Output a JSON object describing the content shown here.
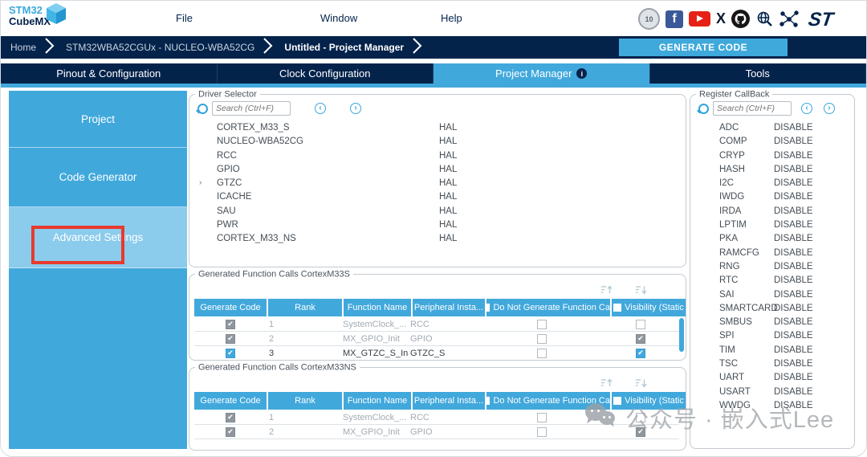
{
  "colors": {
    "accent": "#41a8dc",
    "navy": "#03234b",
    "sidebar_selected": "#8bcbec",
    "red_annotation": "#e8392d",
    "youtube_red": "#e62117",
    "facebook_blue": "#3b5998"
  },
  "menubar": {
    "brand_line1": "STM32",
    "brand_line2": "CubeMX",
    "items": [
      "File",
      "Window",
      "Help"
    ],
    "icons": [
      "badge-10-years-icon",
      "facebook-icon",
      "youtube-icon",
      "x-twitter-icon",
      "github-icon",
      "search-globe-icon",
      "community-icon",
      "st-logo-icon"
    ],
    "badge_text": "10"
  },
  "breadcrumb": {
    "items": [
      "Home",
      "STM32WBA52CGUx - NUCLEO-WBA52CG",
      "Untitled - Project Manager"
    ],
    "generate_button": "GENERATE CODE"
  },
  "tabs": [
    {
      "label": "Pinout & Configuration",
      "active": false,
      "info": false
    },
    {
      "label": "Clock Configuration",
      "active": false,
      "info": false
    },
    {
      "label": "Project Manager",
      "active": true,
      "info": true
    },
    {
      "label": "Tools",
      "active": false,
      "info": false
    }
  ],
  "sidebar": {
    "items": [
      {
        "label": "Project",
        "selected": false,
        "annotated": false
      },
      {
        "label": "Code Generator",
        "selected": false,
        "annotated": false
      },
      {
        "label": "Advanced Settings",
        "selected": true,
        "annotated": true
      }
    ]
  },
  "driver_selector": {
    "title": "Driver Selector",
    "search_placeholder": "Search (Ctrl+F)",
    "rows": [
      {
        "name": "CORTEX_M33_S",
        "driver": "HAL",
        "expandable": false
      },
      {
        "name": "NUCLEO-WBA52CG",
        "driver": "HAL",
        "expandable": false
      },
      {
        "name": "RCC",
        "driver": "HAL",
        "expandable": false
      },
      {
        "name": "GPIO",
        "driver": "HAL",
        "expandable": false
      },
      {
        "name": "GTZC",
        "driver": "HAL",
        "expandable": true
      },
      {
        "name": "ICACHE",
        "driver": "HAL",
        "expandable": false
      },
      {
        "name": "SAU",
        "driver": "HAL",
        "expandable": false
      },
      {
        "name": "PWR",
        "driver": "HAL",
        "expandable": false
      },
      {
        "name": "CORTEX_M33_NS",
        "driver": "HAL",
        "expandable": false
      }
    ]
  },
  "generated_calls_s": {
    "title": "Generated Function Calls CortexM33S",
    "columns": [
      {
        "label": "Generate Code",
        "checkbox": false
      },
      {
        "label": "Rank",
        "checkbox": false
      },
      {
        "label": "Function Name",
        "checkbox": false
      },
      {
        "label": "Peripheral Insta...",
        "checkbox": false
      },
      {
        "label": "Do Not Generate Function Ca",
        "checkbox": true
      },
      {
        "label": "Visibility (Static",
        "checkbox": true
      }
    ],
    "rows": [
      {
        "generate": "on-gray",
        "rank": "1",
        "function": "SystemClock_...",
        "peripheral": "RCC",
        "do_not_generate": "off",
        "visibility": "off",
        "muted": true
      },
      {
        "generate": "on-gray",
        "rank": "2",
        "function": "MX_GPIO_Init",
        "peripheral": "GPIO",
        "do_not_generate": "off",
        "visibility": "on-gray",
        "muted": true
      },
      {
        "generate": "on-blue",
        "rank": "3",
        "function": "MX_GTZC_S_Init",
        "peripheral": "GTZC_S",
        "do_not_generate": "off",
        "visibility": "on-blue",
        "muted": false
      }
    ],
    "has_scrollbar": true
  },
  "generated_calls_ns": {
    "title": "Generated Function Calls CortexM33NS",
    "columns": [
      {
        "label": "Generate Code",
        "checkbox": false
      },
      {
        "label": "Rank",
        "checkbox": false
      },
      {
        "label": "Function Name",
        "checkbox": false
      },
      {
        "label": "Peripheral Insta...",
        "checkbox": false
      },
      {
        "label": "Do Not Generate Function Ca",
        "checkbox": true
      },
      {
        "label": "Visibility (Static",
        "checkbox": true
      }
    ],
    "rows": [
      {
        "generate": "on-gray",
        "rank": "1",
        "function": "SystemClock_...",
        "peripheral": "RCC",
        "do_not_generate": "off",
        "visibility": "off",
        "muted": true
      },
      {
        "generate": "on-gray",
        "rank": "2",
        "function": "MX_GPIO_Init",
        "peripheral": "GPIO",
        "do_not_generate": "off",
        "visibility": "on-gray",
        "muted": true
      }
    ],
    "has_scrollbar": false
  },
  "register_callback": {
    "title": "Register CallBack",
    "search_placeholder": "Search (Ctrl+F)",
    "rows": [
      {
        "peripheral": "ADC",
        "value": "DISABLE"
      },
      {
        "peripheral": "COMP",
        "value": "DISABLE"
      },
      {
        "peripheral": "CRYP",
        "value": "DISABLE"
      },
      {
        "peripheral": "HASH",
        "value": "DISABLE"
      },
      {
        "peripheral": "I2C",
        "value": "DISABLE"
      },
      {
        "peripheral": "IWDG",
        "value": "DISABLE"
      },
      {
        "peripheral": "IRDA",
        "value": "DISABLE"
      },
      {
        "peripheral": "LPTIM",
        "value": "DISABLE"
      },
      {
        "peripheral": "PKA",
        "value": "DISABLE"
      },
      {
        "peripheral": "RAMCFG",
        "value": "DISABLE"
      },
      {
        "peripheral": "RNG",
        "value": "DISABLE"
      },
      {
        "peripheral": "RTC",
        "value": "DISABLE"
      },
      {
        "peripheral": "SAI",
        "value": "DISABLE"
      },
      {
        "peripheral": "SMARTCARD",
        "value": "DISABLE"
      },
      {
        "peripheral": "SMBUS",
        "value": "DISABLE"
      },
      {
        "peripheral": "SPI",
        "value": "DISABLE"
      },
      {
        "peripheral": "TIM",
        "value": "DISABLE"
      },
      {
        "peripheral": "TSC",
        "value": "DISABLE"
      },
      {
        "peripheral": "UART",
        "value": "DISABLE"
      },
      {
        "peripheral": "USART",
        "value": "DISABLE"
      },
      {
        "peripheral": "WWDG",
        "value": "DISABLE"
      }
    ]
  },
  "watermark": {
    "text": "公众号 · 嵌入式Lee"
  }
}
